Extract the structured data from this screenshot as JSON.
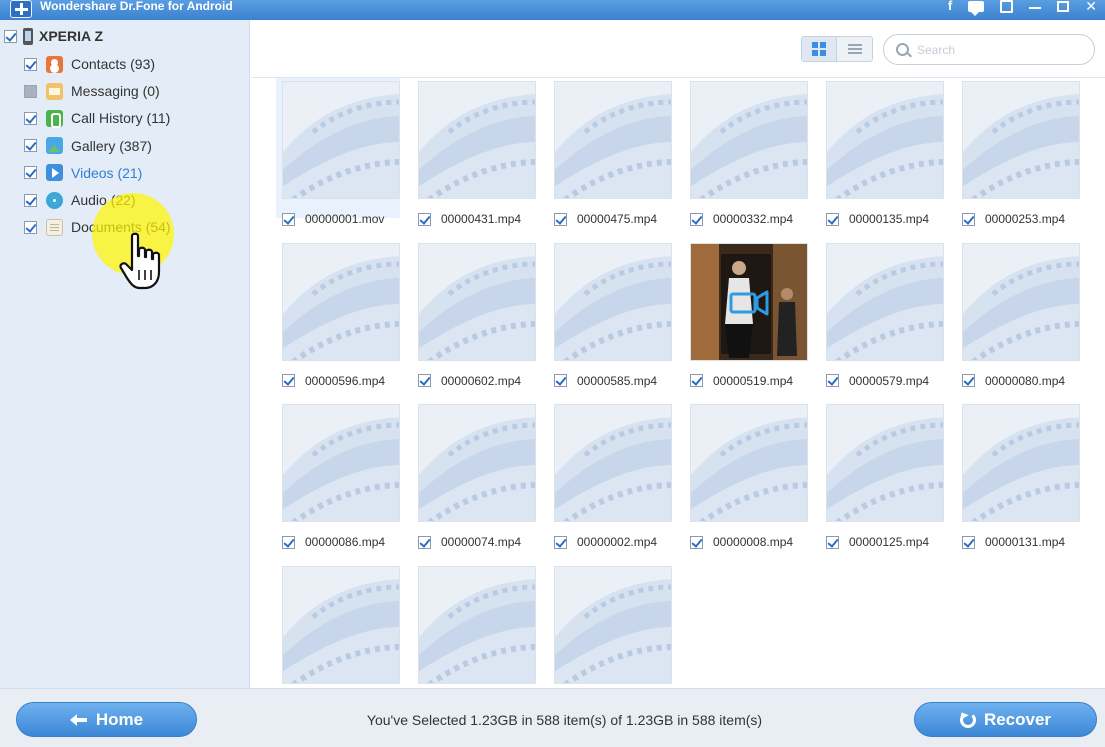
{
  "window": {
    "title": "Wondershare Dr.Fone for Android",
    "controls": [
      "facebook-icon",
      "chat-icon",
      "feedback-icon",
      "minimize-icon",
      "maximize-icon",
      "close-icon"
    ],
    "facebook_glyph": "f",
    "close_glyph": "✕"
  },
  "sidebar": {
    "device": {
      "name": "XPERIA Z",
      "checked": true
    },
    "categories": [
      {
        "label": "Contacts (93)",
        "icon": "contacts-icon",
        "checked": true,
        "active": false
      },
      {
        "label": "Messaging (0)",
        "icon": "messaging-icon",
        "checked": false,
        "active": false
      },
      {
        "label": "Call History  (11)",
        "icon": "call-history-icon",
        "checked": true,
        "active": false
      },
      {
        "label": "Gallery (387)",
        "icon": "gallery-icon",
        "checked": true,
        "active": false
      },
      {
        "label": "Videos (21)",
        "icon": "videos-icon",
        "checked": true,
        "active": true
      },
      {
        "label": "Audio (22)",
        "icon": "audio-icon",
        "checked": true,
        "active": false
      },
      {
        "label": "Documents (54)",
        "icon": "documents-icon",
        "checked": true,
        "active": false
      }
    ]
  },
  "toolbar": {
    "view_modes": [
      "grid-view",
      "list-view"
    ],
    "active_view": "grid-view",
    "search_placeholder": "Search",
    "search_value": ""
  },
  "files": [
    {
      "name": "00000001.mov",
      "checked": true,
      "thumb": "placeholder",
      "selected": true
    },
    {
      "name": "00000431.mp4",
      "checked": true,
      "thumb": "placeholder"
    },
    {
      "name": "00000475.mp4",
      "checked": true,
      "thumb": "placeholder"
    },
    {
      "name": "00000332.mp4",
      "checked": true,
      "thumb": "placeholder"
    },
    {
      "name": "00000135.mp4",
      "checked": true,
      "thumb": "placeholder"
    },
    {
      "name": "00000253.mp4",
      "checked": true,
      "thumb": "placeholder"
    },
    {
      "name": "00000596.mp4",
      "checked": true,
      "thumb": "placeholder"
    },
    {
      "name": "00000602.mp4",
      "checked": true,
      "thumb": "placeholder"
    },
    {
      "name": "00000585.mp4",
      "checked": true,
      "thumb": "placeholder"
    },
    {
      "name": "00000519.mp4",
      "checked": true,
      "thumb": "video-frame"
    },
    {
      "name": "00000579.mp4",
      "checked": true,
      "thumb": "placeholder"
    },
    {
      "name": "00000080.mp4",
      "checked": true,
      "thumb": "placeholder"
    },
    {
      "name": "00000086.mp4",
      "checked": true,
      "thumb": "placeholder"
    },
    {
      "name": "00000074.mp4",
      "checked": true,
      "thumb": "placeholder"
    },
    {
      "name": "00000002.mp4",
      "checked": true,
      "thumb": "placeholder"
    },
    {
      "name": "00000008.mp4",
      "checked": true,
      "thumb": "placeholder"
    },
    {
      "name": "00000125.mp4",
      "checked": true,
      "thumb": "placeholder"
    },
    {
      "name": "00000131.mp4",
      "checked": true,
      "thumb": "placeholder"
    },
    {
      "name": "",
      "checked": false,
      "thumb": "placeholder"
    },
    {
      "name": "",
      "checked": false,
      "thumb": "placeholder"
    },
    {
      "name": "",
      "checked": false,
      "thumb": "placeholder"
    }
  ],
  "footer": {
    "home_label": "Home",
    "recover_label": "Recover",
    "selection_status": "You've Selected 1.23GB in 588 item(s) of 1.23GB in 588 item(s)"
  },
  "colors": {
    "accent": "#3c87d6",
    "titlebar": "#4a90d9",
    "sidebar_bg": "#e4ecf7",
    "active_category": "#2e7fd6",
    "cursor_highlight": "#fff500"
  }
}
